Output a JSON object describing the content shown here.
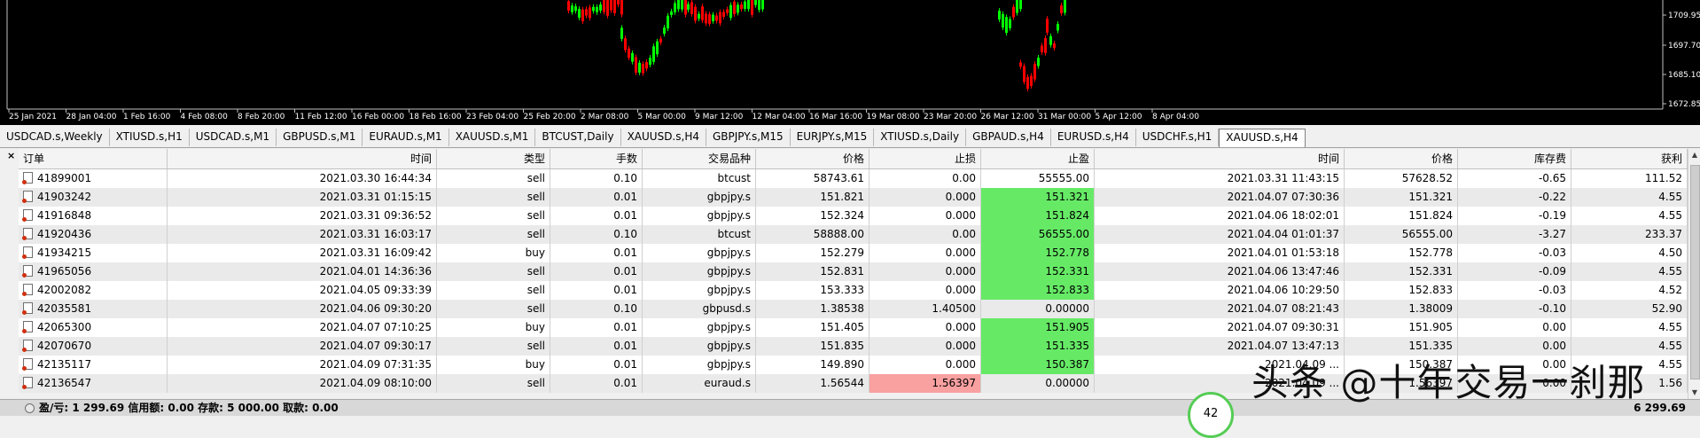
{
  "chart": {
    "x_labels": [
      "25 Jan 2021",
      "28 Jan 04:00",
      "1 Feb 16:00",
      "4 Feb 08:00",
      "8 Feb 20:00",
      "11 Feb 12:00",
      "16 Feb 00:00",
      "18 Feb 16:00",
      "23 Feb 04:00",
      "25 Feb 20:00",
      "2 Mar 08:00",
      "5 Mar 00:00",
      "9 Mar 12:00",
      "12 Mar 04:00",
      "16 Mar 16:00",
      "19 Mar 08:00",
      "23 Mar 20:00",
      "26 Mar 12:00",
      "31 Mar 00:00",
      "5 Apr 12:00",
      "8 Apr 04:00"
    ],
    "y_labels": [
      "1709.95",
      "1697.70",
      "1685.10",
      "1672.85"
    ],
    "bull_color": "#00ff00",
    "bear_color": "#ff0000"
  },
  "tabs": [
    "USDCAD.s,Weekly",
    "XTIUSD.s,H1",
    "USDCAD.s,M1",
    "GBPUSD.s,M1",
    "EURAUD.s,M1",
    "XAUUSD.s,M1",
    "BTCUST,Daily",
    "XAUUSD.s,H4",
    "GBPJPY.s,M15",
    "EURJPY.s,M15",
    "XTIUSD.s,Daily",
    "GBPAUD.s,H4",
    "EURUSD.s,H4",
    "USDCHF.s,H1",
    "XAUUSD.s,H4"
  ],
  "active_tab_index": 14,
  "table": {
    "columns": [
      "订单",
      "时间",
      "类型",
      "手数",
      "交易品种",
      "价格",
      "止损",
      "止盈",
      "时间",
      "价格",
      "库存费",
      "获利"
    ],
    "rows": [
      [
        "41899001",
        "2021.03.30 16:44:34",
        "sell",
        "0.10",
        "btcust",
        "58743.61",
        "0.00",
        "55555.00",
        "2021.03.31 11:43:15",
        "57628.52",
        "-0.65",
        "111.52"
      ],
      [
        "41903242",
        "2021.03.31 01:15:15",
        "sell",
        "0.01",
        "gbpjpy.s",
        "151.821",
        "0.000",
        "151.321",
        "2021.04.07 07:30:36",
        "151.321",
        "-0.22",
        "4.55"
      ],
      [
        "41916848",
        "2021.03.31 09:36:52",
        "sell",
        "0.01",
        "gbpjpy.s",
        "152.324",
        "0.000",
        "151.824",
        "2021.04.06 18:02:01",
        "151.824",
        "-0.19",
        "4.55"
      ],
      [
        "41920436",
        "2021.03.31 16:03:17",
        "sell",
        "0.10",
        "btcust",
        "58888.00",
        "0.00",
        "56555.00",
        "2021.04.04 01:01:37",
        "56555.00",
        "-3.27",
        "233.37"
      ],
      [
        "41934215",
        "2021.03.31 16:09:42",
        "buy",
        "0.01",
        "gbpjpy.s",
        "152.279",
        "0.000",
        "152.778",
        "2021.04.01 01:53:18",
        "152.778",
        "-0.03",
        "4.50"
      ],
      [
        "41965056",
        "2021.04.01 14:36:36",
        "sell",
        "0.01",
        "gbpjpy.s",
        "152.831",
        "0.000",
        "152.331",
        "2021.04.06 13:47:46",
        "152.331",
        "-0.09",
        "4.55"
      ],
      [
        "42002082",
        "2021.04.05 09:33:39",
        "sell",
        "0.01",
        "gbpjpy.s",
        "153.333",
        "0.000",
        "152.833",
        "2021.04.06 10:29:50",
        "152.833",
        "-0.03",
        "4.52"
      ],
      [
        "42035581",
        "2021.04.06 09:30:20",
        "sell",
        "0.10",
        "gbpusd.s",
        "1.38538",
        "1.40500",
        "0.00000",
        "2021.04.07 08:21:43",
        "1.38009",
        "-0.10",
        "52.90"
      ],
      [
        "42065300",
        "2021.04.07 07:10:25",
        "buy",
        "0.01",
        "gbpjpy.s",
        "151.405",
        "0.000",
        "151.905",
        "2021.04.07 09:30:31",
        "151.905",
        "0.00",
        "4.55"
      ],
      [
        "42070670",
        "2021.04.07 09:30:17",
        "sell",
        "0.01",
        "gbpjpy.s",
        "151.835",
        "0.000",
        "151.335",
        "2021.04.07 13:47:13",
        "151.335",
        "0.00",
        "4.55"
      ],
      [
        "42135117",
        "2021.04.09 07:31:35",
        "buy",
        "0.01",
        "gbpjpy.s",
        "149.890",
        "0.000",
        "150.387",
        "2021.04.09 ...",
        "150.387",
        "0.00",
        "4.55"
      ],
      [
        "42136547",
        "2021.04.09 08:10:00",
        "sell",
        "0.01",
        "euraud.s",
        "1.56544",
        "1.56397",
        "0.00000",
        "2021.04.09 ...",
        "1.56397",
        "0.00",
        "1.56"
      ]
    ],
    "highlight_tp_rows": [
      1,
      2,
      3,
      4,
      5,
      6,
      8,
      9,
      10
    ],
    "highlight_sl_rows": [
      11
    ],
    "highlight_green": "#66ea66",
    "highlight_red": "#f9a0a0"
  },
  "status": {
    "summary": "盈/亏: 1 299.69  信用额: 0.00  存款: 5 000.00  取款: 0.00",
    "total": "6 299.69"
  },
  "watermark": "头条 @十年交易一刹那",
  "bubble": "42"
}
